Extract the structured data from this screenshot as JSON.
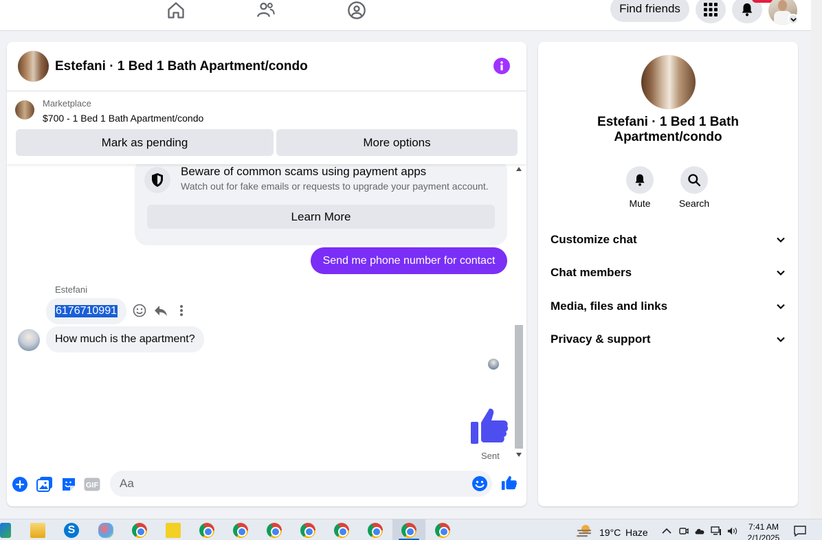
{
  "topnav": {
    "find_friends": "Find friends"
  },
  "chat": {
    "title": "Estefani · 1 Bed 1 Bath Apartment/condo",
    "marketplace_label": "Marketplace",
    "listing": "$700 - 1 Bed 1 Bath Apartment/condo",
    "mark_pending": "Mark as pending",
    "more_options": "More options",
    "scam_title": "Beware of common scams using payment apps",
    "scam_sub": "Watch out for fake emails or requests to upgrade your payment account.",
    "learn_more": "Learn More",
    "outgoing_message": "Send me phone number for contact",
    "sender_name": "Estefani",
    "incoming_phone": "6176710991",
    "incoming_question": "How much is the apartment?",
    "sent_status": "Sent",
    "composer_placeholder": "Aa",
    "gif_label": "GIF"
  },
  "info": {
    "name": "Estefani · 1 Bed 1 Bath Apartment/condo",
    "mute": "Mute",
    "search": "Search",
    "sections": [
      "Customize chat",
      "Chat members",
      "Media, files and links",
      "Privacy & support"
    ]
  },
  "taskbar": {
    "temperature": "19°C",
    "weather": "Haze",
    "time": "7:41 AM",
    "date": "2/1/2025"
  },
  "colors": {
    "accent": "#7a2df7",
    "info_purple": "#a033ff",
    "composer_blue": "#0866ff",
    "thumb_blue": "#4e4ef0"
  }
}
